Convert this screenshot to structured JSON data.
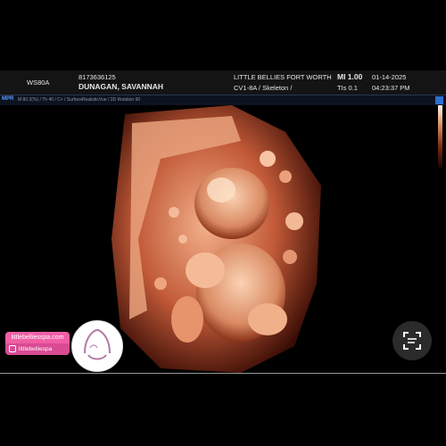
{
  "header": {
    "station": "WS80A",
    "patient_id": "8173636125",
    "patient_name": "DUNAGAN, SAVANNAH",
    "clinic": "LITTLE BELLIES FORT WORTH",
    "probe_preset": "CV1-8A / Skeleton /",
    "mi": "MI  1.00",
    "tis": "TIs 0.1",
    "date": "01-14-2025",
    "time": "04:23:37 PM"
  },
  "toolbar": {
    "mode": "MPR",
    "status": "M 80.2(%) / Th 40 / C+ / SurfaceRealisticVue / 3D Rotation 90"
  },
  "branding": {
    "website": "littlebelliesspa.com",
    "instagram": "littlebelliespa"
  },
  "icons": {
    "logo": "little-bellies-logo",
    "lens": "google-lens-icon"
  }
}
